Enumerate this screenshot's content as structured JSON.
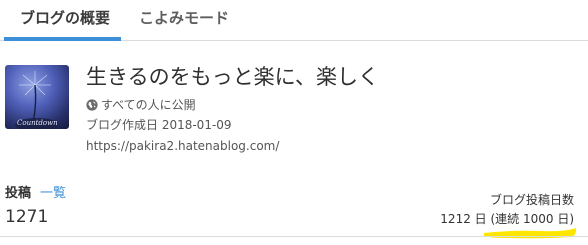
{
  "tabs": [
    {
      "label": "ブログの概要",
      "active": true
    },
    {
      "label": "こよみモード",
      "active": false
    }
  ],
  "blog": {
    "thumbnail_caption": "Countdown",
    "title": "生きるのをもっと楽に、楽しく",
    "visibility_icon": "globe-icon",
    "visibility": "すべての人に公開",
    "created": "ブログ作成日 2018-01-09",
    "url": "https://pakira2.hatenablog.com/"
  },
  "stats": {
    "posts_label": "投稿",
    "list_link": "一覧",
    "post_count": "1271",
    "days_label": "ブログ投稿日数",
    "days_value": "1212 日 (連続 1000 日)"
  },
  "colors": {
    "accent": "#3c8fd8",
    "highlight": "#ffe600"
  }
}
